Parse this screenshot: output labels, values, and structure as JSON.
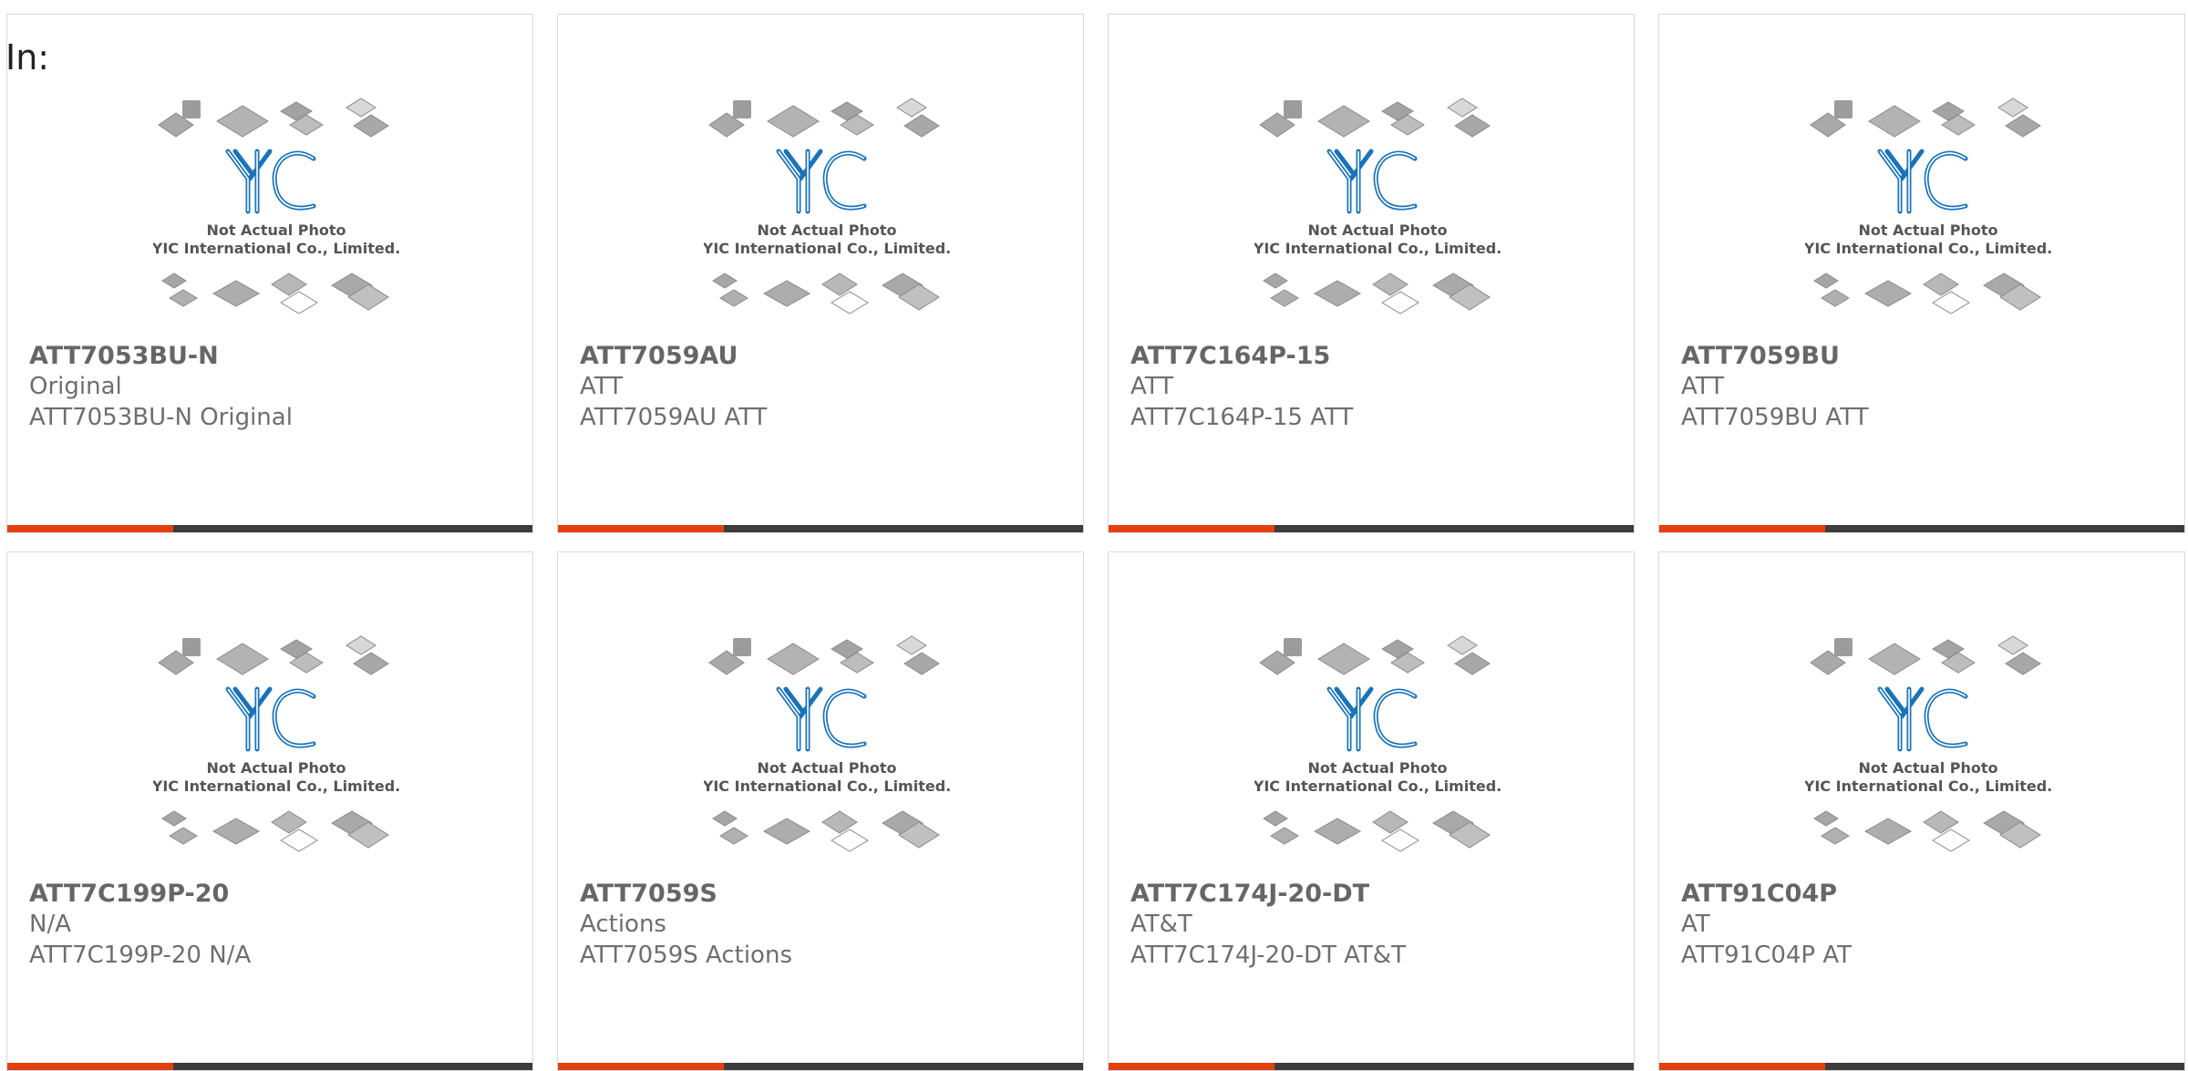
{
  "header": {
    "label": "In:"
  },
  "placeholder": {
    "line1": "Not Actual Photo",
    "line2": "YIC International Co., Limited.",
    "logo_text": "YIC"
  },
  "colors": {
    "accent": "#e4400e",
    "bar": "#3c3c3c",
    "logo": "#1a73b8"
  },
  "products": [
    {
      "part": "ATT7053BU-N",
      "manufacturer": "Original",
      "description": "ATT7053BU-N Original"
    },
    {
      "part": "ATT7059AU",
      "manufacturer": "ATT",
      "description": "ATT7059AU ATT"
    },
    {
      "part": "ATT7C164P-15",
      "manufacturer": "ATT",
      "description": "ATT7C164P-15 ATT"
    },
    {
      "part": "ATT7059BU",
      "manufacturer": "ATT",
      "description": "ATT7059BU ATT"
    },
    {
      "part": "ATT7C199P-20",
      "manufacturer": "N/A",
      "description": "ATT7C199P-20 N/A"
    },
    {
      "part": "ATT7059S",
      "manufacturer": "Actions",
      "description": "ATT7059S Actions"
    },
    {
      "part": "ATT7C174J-20-DT",
      "manufacturer": "AT&T",
      "description": "ATT7C174J-20-DT AT&T"
    },
    {
      "part": "ATT91C04P",
      "manufacturer": "AT",
      "description": "ATT91C04P AT"
    }
  ]
}
